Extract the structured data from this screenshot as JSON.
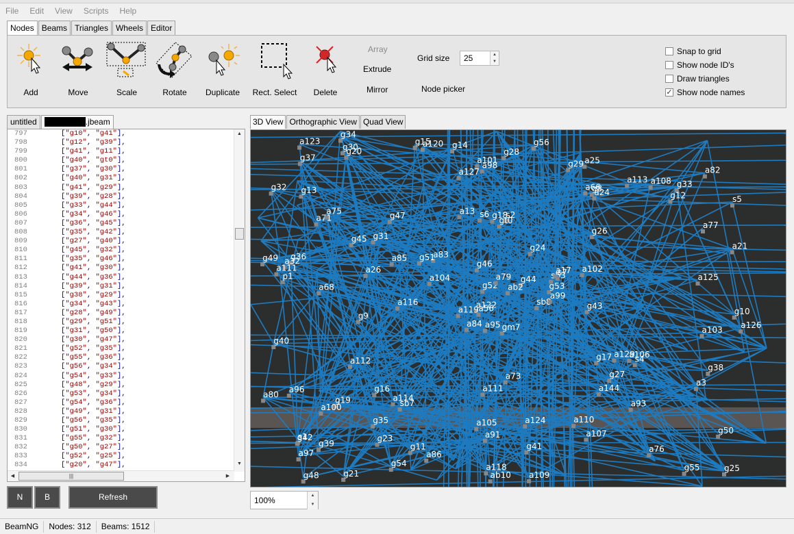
{
  "menu": [
    "File",
    "Edit",
    "View",
    "Scripts",
    "Help"
  ],
  "tabs": [
    "Nodes",
    "Beams",
    "Triangles",
    "Wheels",
    "Editor"
  ],
  "active_tab": "Nodes",
  "tools": {
    "add": "Add",
    "move": "Move",
    "scale": "Scale",
    "rotate": "Rotate",
    "duplicate": "Duplicate",
    "rect_select": "Rect. Select",
    "delete": "Delete"
  },
  "actions": {
    "array": "Array",
    "extrude": "Extrude",
    "mirror": "Mirror",
    "node_picker": "Node picker"
  },
  "grid": {
    "label": "Grid size",
    "value": "25"
  },
  "options": {
    "snap": {
      "label": "Snap to grid",
      "checked": false
    },
    "ids": {
      "label": "Show node ID's",
      "checked": false
    },
    "triangles": {
      "label": "Draw triangles",
      "checked": false
    },
    "names": {
      "label": "Show node names",
      "checked": true
    }
  },
  "file_tabs": {
    "untitled": "untitled",
    "current_suffix": ".jbeam"
  },
  "editor": {
    "line_numbers": [
      "797",
      "798",
      "799",
      "800",
      "801",
      "802",
      "803",
      "804",
      "805",
      "806",
      "807",
      "808",
      "809",
      "810",
      "811",
      "812",
      "813",
      "814",
      "815",
      "816",
      "817",
      "818",
      "819",
      "820",
      "821",
      "822",
      "823",
      "824",
      "825",
      "826",
      "827",
      "828",
      "829",
      "830",
      "831",
      "832",
      "833",
      "834"
    ],
    "lines": [
      [
        "g10",
        "g41"
      ],
      [
        "g12",
        "g39"
      ],
      [
        "g41",
        "g11"
      ],
      [
        "g40",
        "gt0"
      ],
      [
        "g37",
        "g30"
      ],
      [
        "g40",
        "g31"
      ],
      [
        "g41",
        "g29"
      ],
      [
        "g39",
        "g28"
      ],
      [
        "g33",
        "g44"
      ],
      [
        "g34",
        "g46"
      ],
      [
        "g36",
        "g45"
      ],
      [
        "g35",
        "g42"
      ],
      [
        "g27",
        "g40"
      ],
      [
        "g45",
        "g32"
      ],
      [
        "g35",
        "g46"
      ],
      [
        "g41",
        "g30"
      ],
      [
        "g44",
        "g36"
      ],
      [
        "g39",
        "g31"
      ],
      [
        "g38",
        "g29"
      ],
      [
        "g34",
        "g43"
      ],
      [
        "g28",
        "g49"
      ],
      [
        "g29",
        "g51"
      ],
      [
        "g31",
        "g50"
      ],
      [
        "g30",
        "g47"
      ],
      [
        "g52",
        "g35"
      ],
      [
        "g55",
        "g36"
      ],
      [
        "g56",
        "g34"
      ],
      [
        "g54",
        "g33"
      ],
      [
        "g48",
        "g29"
      ],
      [
        "g53",
        "g34"
      ],
      [
        "g54",
        "g36"
      ],
      [
        "g49",
        "g31"
      ],
      [
        "g56",
        "g35"
      ],
      [
        "g51",
        "g30"
      ],
      [
        "g55",
        "g32"
      ],
      [
        "g50",
        "g27"
      ],
      [
        "g52",
        "g25"
      ],
      [
        "g20",
        "g47"
      ]
    ]
  },
  "buttons": {
    "n": "N",
    "b": "B",
    "refresh": "Refresh"
  },
  "view_tabs": [
    "3D View",
    "Orthographic View",
    "Quad View"
  ],
  "active_view": "3D View",
  "zoom": "100%",
  "node_labels": [
    "gm7",
    "a71",
    "a56",
    "s1",
    "sb3",
    "sb7",
    "a25",
    "s2",
    "g8",
    "sb8",
    "g20",
    "g25",
    "a68",
    "s5",
    "a84",
    "g26",
    "g21",
    "s6",
    "g24",
    "g19",
    "a83",
    "a97",
    "g23",
    "g18",
    "s7",
    "s4",
    "a75",
    "a98",
    "p1",
    "g17",
    "a21",
    "a122",
    "a105",
    "g52",
    "g47",
    "a113",
    "a114",
    "g55",
    "g50",
    "a106",
    "g56",
    "g51",
    "a26",
    "a144",
    "g54",
    "g49",
    "g53",
    "g48",
    "a91",
    "a99",
    "a100",
    "a77",
    "g32",
    "g27",
    "a107",
    "g35",
    "g30",
    "a123",
    "a124",
    "g33",
    "g28",
    "a116",
    "g36",
    "g31",
    "a108",
    "g34",
    "g29",
    "a127",
    "a79",
    "a80",
    "a111",
    "a86",
    "a129",
    "a85",
    "g42",
    "g37",
    "g45",
    "g40",
    "g46",
    "g41",
    "g44",
    "g39",
    "g43",
    "g38",
    "a118",
    "a125",
    "a73",
    "a76",
    "a109",
    "a110",
    "a101",
    "a126",
    "a102",
    "a93",
    "ab2",
    "a3",
    "a32",
    "ab10",
    "a66",
    "a24",
    "g9",
    "g15",
    "g10",
    "a111",
    "a112",
    "g16",
    "g11",
    "a17",
    "g12",
    "a104",
    "a103",
    "g13",
    "gt0",
    "a119",
    "a120",
    "a96",
    "a95",
    "a82",
    "a13",
    "g14"
  ],
  "status": {
    "app": "BeamNG",
    "nodes": "Nodes: 312",
    "beams": "Beams: 1512"
  },
  "colors": {
    "beam": "#1e7bc0",
    "viewport_bg": "#2c2e2e",
    "node": "#888888"
  }
}
